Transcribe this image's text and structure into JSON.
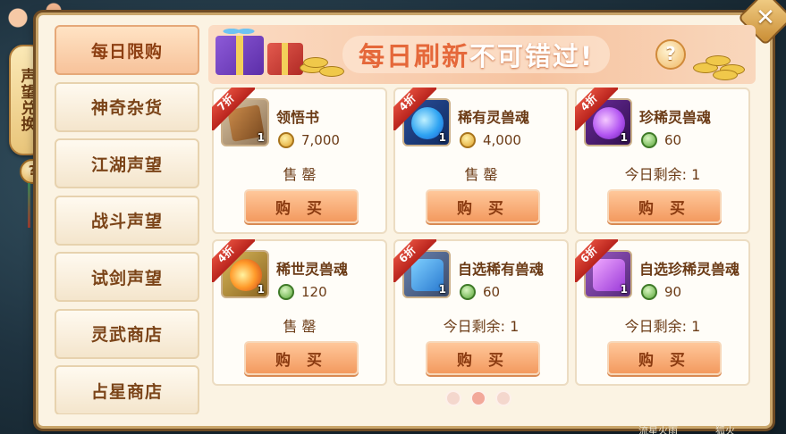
{
  "side_tab": {
    "label": "声望兑换"
  },
  "categories": [
    {
      "label": "每日限购",
      "active": true
    },
    {
      "label": "神奇杂货",
      "active": false
    },
    {
      "label": "江湖声望",
      "active": false
    },
    {
      "label": "战斗声望",
      "active": false
    },
    {
      "label": "试剑声望",
      "active": false
    },
    {
      "label": "灵武商店",
      "active": false
    },
    {
      "label": "占星商店",
      "active": false
    }
  ],
  "banner": {
    "text_part1": "每日刷新",
    "text_part2": "不可错过!"
  },
  "items": [
    {
      "discount": "7折",
      "name": "领悟书",
      "currency": "gold",
      "price": "7,000",
      "stock": "售 罄",
      "qty": "1",
      "icon": "book-icon",
      "buy_label": "购 买"
    },
    {
      "discount": "4折",
      "name": "稀有灵兽魂",
      "currency": "gold",
      "price": "4,000",
      "stock": "售 罄",
      "qty": "1",
      "icon": "blue-beast-soul-icon",
      "buy_label": "购 买"
    },
    {
      "discount": "4折",
      "name": "珍稀灵兽魂",
      "currency": "jade",
      "price": "60",
      "stock": "今日剩余: 1",
      "qty": "1",
      "icon": "purple-beast-soul-icon",
      "buy_label": "购 买"
    },
    {
      "discount": "4折",
      "name": "稀世灵兽魂",
      "currency": "jade",
      "price": "120",
      "stock": "售 罄",
      "qty": "1",
      "icon": "gold-beast-soul-icon",
      "buy_label": "购 买"
    },
    {
      "discount": "6折",
      "name": "自选稀有兽魂",
      "currency": "jade",
      "price": "60",
      "stock": "今日剩余: 1",
      "qty": "1",
      "icon": "blue-gift-box-icon",
      "buy_label": "购 买"
    },
    {
      "discount": "6折",
      "name": "自选珍稀灵兽魂",
      "currency": "jade",
      "price": "90",
      "stock": "今日剩余: 1",
      "qty": "1",
      "icon": "purple-gift-box-icon",
      "buy_label": "购 买"
    }
  ],
  "pager": {
    "pages": 3,
    "current": 2
  },
  "background_text": {
    "left": "流星火雨",
    "right": "狐火"
  },
  "colors": {
    "accent": "#f39a5f",
    "discount_red": "#c8261d",
    "text_brown": "#6b3b16"
  }
}
